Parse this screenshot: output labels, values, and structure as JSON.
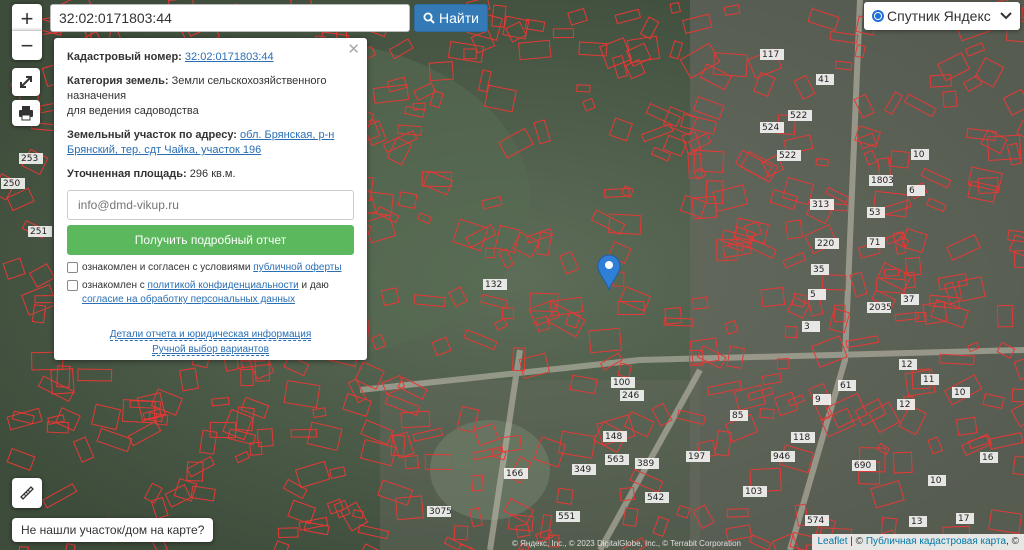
{
  "search": {
    "value": "32:02:0171803:44",
    "button_label": "Найти"
  },
  "layer_select": {
    "selected": "Спутник Яндекс"
  },
  "panel": {
    "cadastral_label": "Кадастровый номер:",
    "cadastral_value": "32:02:0171803:44",
    "category_label": "Категория земель:",
    "category_value": "Земли сельскохозяйственного назначения",
    "category_value2": "для ведения садоводства",
    "address_label": "Земельный участок по адресу:",
    "address_value": "обл. Брянская, р-н Брянский, тер. сдт Чайка, участок 196",
    "area_label": "Уточненная площадь:",
    "area_value": "296 кв.м.",
    "email_placeholder": "info@dmd-vikup.ru",
    "report_button": "Получить подробный отчет",
    "consent1_text": "ознакомлен и согласен с условиями ",
    "consent1_link": "публичной оферты",
    "consent2_text": "ознакомлен с ",
    "consent2_link1": "политикой конфиденциальности",
    "consent2_mid": " и даю",
    "consent2_link2": "согласие на обработку персональных данных",
    "details_link": "Детали отчета и юридическая информация",
    "manual_link": "Ручной выбор вариантов"
  },
  "not_found_button": "Не нашли участок/дом на карте?",
  "attribution": {
    "leaflet": "Leaflet",
    "sep": " | © ",
    "map": "Публичная кадастровая карта",
    "trail": ", ©"
  },
  "map_copyright": "© Яндекс, Inc., © 2023 DigitalGlobe, Inc., © Terrabit Corporation",
  "colors": {
    "parcel_line": "#e53935",
    "button_blue": "#337ab7",
    "button_green": "#5cb85c",
    "marker": "#2f7fd6"
  },
  "plot_labels": [
    "117",
    "41",
    "522",
    "524",
    "522",
    "313",
    "220",
    "35",
    "5",
    "3",
    "132",
    "166",
    "3075",
    "100",
    "246",
    "85",
    "148",
    "349",
    "563",
    "389",
    "542",
    "197",
    "103",
    "551",
    "574",
    "946",
    "118",
    "690",
    "61",
    "9",
    "10",
    "6",
    "12",
    "11",
    "10",
    "12",
    "16",
    "10",
    "13",
    "17",
    "253",
    "250",
    "251",
    "2035",
    "1803",
    "53",
    "71",
    "37"
  ]
}
